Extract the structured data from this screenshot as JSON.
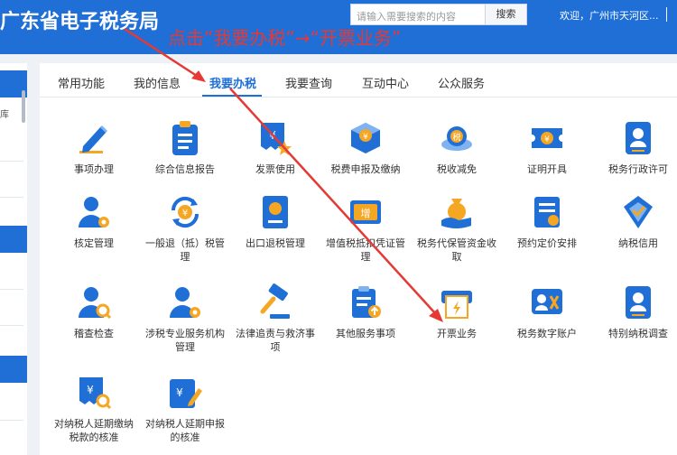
{
  "header": {
    "title": "广东省电子税务局",
    "search_placeholder": "请输入需要搜索的内容",
    "search_button": "搜索",
    "welcome": "欢迎，广州市天河区..."
  },
  "instruction": "点击“我要办税”→“开票业务”",
  "sidebar": {
    "partial_char": "库"
  },
  "tabs": [
    "常用功能",
    "我的信息",
    "我要办税",
    "我要查询",
    "互动中心",
    "公众服务"
  ],
  "active_tab": "我要办税",
  "items": [
    {
      "label": "事项办理",
      "icon": "pen-icon"
    },
    {
      "label": "综合信息报告",
      "icon": "clipboard-icon"
    },
    {
      "label": "发票使用",
      "icon": "invoice-star-icon"
    },
    {
      "label": "税费申报及缴纳",
      "icon": "yuan-cube-icon"
    },
    {
      "label": "税收减免",
      "icon": "coin-icon"
    },
    {
      "label": "证明开具",
      "icon": "yuan-ticket-icon"
    },
    {
      "label": "税务行政许可",
      "icon": "id-badge-icon"
    },
    {
      "label": "核定管理",
      "icon": "user-gear-icon"
    },
    {
      "label": "一般退（抵）税管理",
      "icon": "yuan-refresh-icon"
    },
    {
      "label": "出口退税管理",
      "icon": "export-book-icon"
    },
    {
      "label": "增值税抵扣凭证管理",
      "icon": "voucher-icon"
    },
    {
      "label": "税务代保管资金收取",
      "icon": "money-hand-icon"
    },
    {
      "label": "预约定价安排",
      "icon": "document-icon"
    },
    {
      "label": "纳税信用",
      "icon": "credit-icon"
    },
    {
      "label": "稽查检查",
      "icon": "user-search-icon"
    },
    {
      "label": "涉税专业服务机构管理",
      "icon": "user-gear-icon"
    },
    {
      "label": "法律追责与救济事项",
      "icon": "gavel-icon"
    },
    {
      "label": "其他服务事项",
      "icon": "clipboard-upload-icon"
    },
    {
      "label": "开票业务",
      "icon": "invoice-printer-icon"
    },
    {
      "label": "税务数字账户",
      "icon": "digital-account-icon"
    },
    {
      "label": "特别纳税调查",
      "icon": "id-badge-icon"
    },
    {
      "label": "对纳税人延期缴纳税款的核准",
      "icon": "yuan-search-icon"
    },
    {
      "label": "对纳税人延期申报的核准",
      "icon": "yuan-pen-icon"
    }
  ],
  "colors": {
    "brand_blue": "#1f6fd6",
    "accent_orange": "#f5a623",
    "annotation_red": "#e53935"
  }
}
